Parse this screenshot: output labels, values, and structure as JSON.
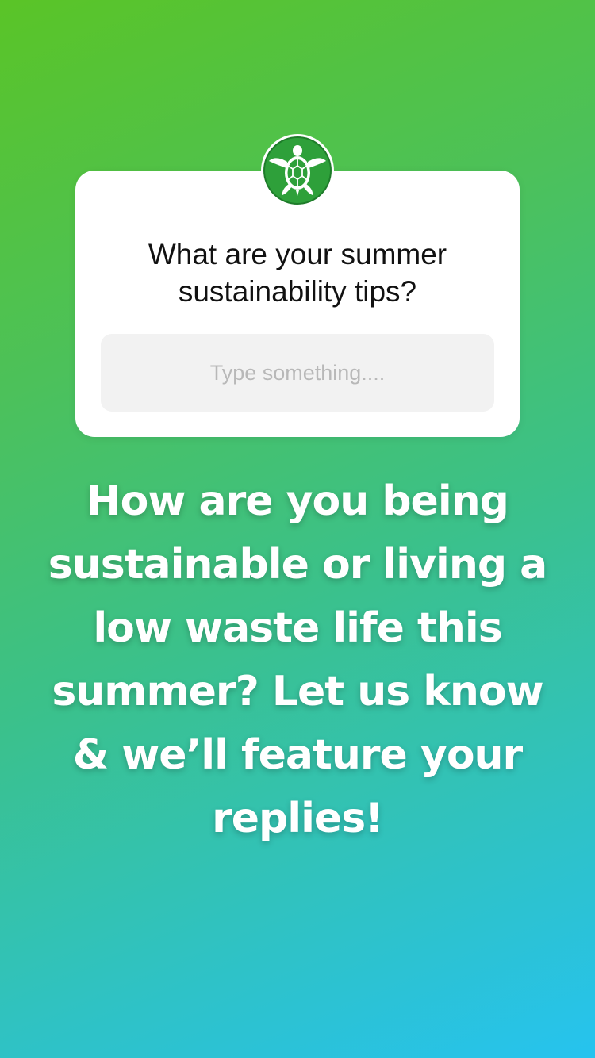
{
  "question_sticker": {
    "question": "What are your summer\nsustainability tips?",
    "answer_placeholder": "Type something....",
    "avatar_icon": "turtle-icon"
  },
  "caption": {
    "text": "How are you being\nsustainable or living a\nlow waste life this\nsummer? Let us know\n& we’ll feature your\nreplies!"
  },
  "colors": {
    "gradient_top": "#5ac427",
    "gradient_bottom": "#26c3ef",
    "card_background": "#ffffff",
    "field_background": "#f2f2f2",
    "avatar_green": "#2ea03a"
  }
}
